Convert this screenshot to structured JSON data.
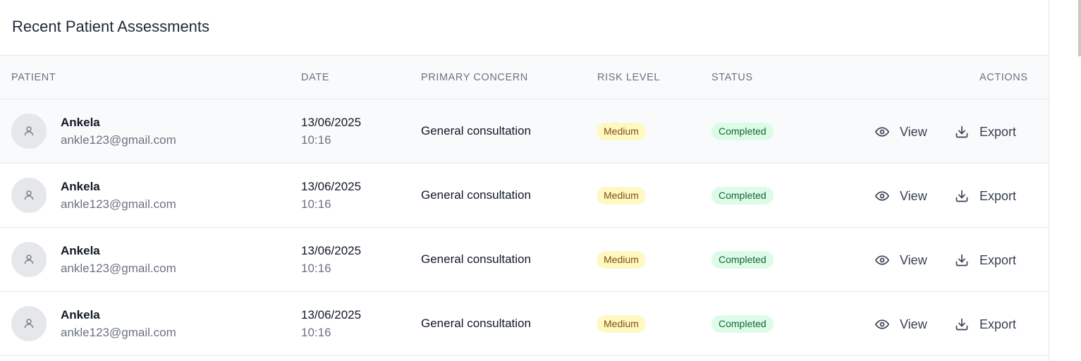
{
  "panel": {
    "title": "Recent Patient Assessments"
  },
  "table": {
    "headers": {
      "patient": "Patient",
      "date": "Date",
      "primary_concern": "Primary Concern",
      "risk_level": "Risk Level",
      "status": "Status",
      "actions": "Actions"
    },
    "rows": [
      {
        "name": "Ankela",
        "email": "ankle123@gmail.com",
        "date": "13/06/2025",
        "time": "10:16",
        "concern": "General consultation",
        "risk": "Medium",
        "status": "Completed",
        "view_label": "View",
        "export_label": "Export"
      },
      {
        "name": "Ankela",
        "email": "ankle123@gmail.com",
        "date": "13/06/2025",
        "time": "10:16",
        "concern": "General consultation",
        "risk": "Medium",
        "status": "Completed",
        "view_label": "View",
        "export_label": "Export"
      },
      {
        "name": "Ankela",
        "email": "ankle123@gmail.com",
        "date": "13/06/2025",
        "time": "10:16",
        "concern": "General consultation",
        "risk": "Medium",
        "status": "Completed",
        "view_label": "View",
        "export_label": "Export"
      },
      {
        "name": "Ankela",
        "email": "ankle123@gmail.com",
        "date": "13/06/2025",
        "time": "10:16",
        "concern": "General consultation",
        "risk": "Medium",
        "status": "Completed",
        "view_label": "View",
        "export_label": "Export"
      }
    ]
  },
  "icons": {
    "avatar": "user-icon",
    "view": "eye-icon",
    "export": "download-icon"
  },
  "colors": {
    "risk_medium_bg": "#fef9c3",
    "risk_medium_text": "#854d0e",
    "status_completed_bg": "#dcfce7",
    "status_completed_text": "#166534"
  }
}
